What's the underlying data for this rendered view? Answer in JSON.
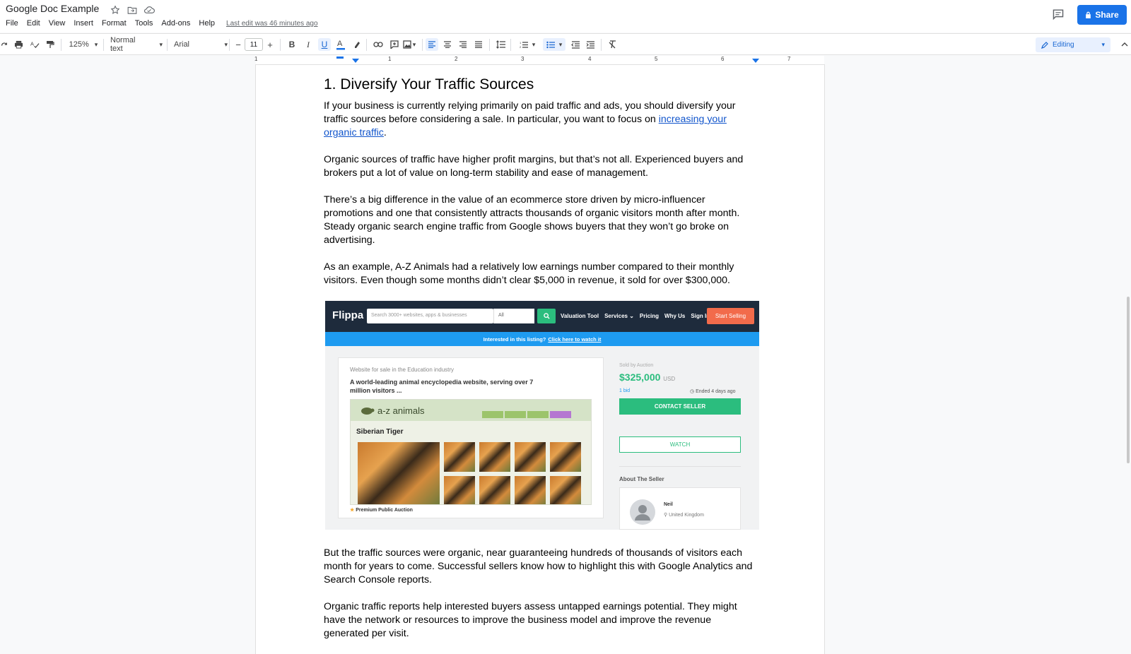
{
  "header": {
    "doc_title": "Google Doc Example",
    "last_edit": "Last edit was 46 minutes ago",
    "share_label": "Share",
    "menu": [
      "File",
      "Edit",
      "View",
      "Insert",
      "Format",
      "Tools",
      "Add-ons",
      "Help"
    ]
  },
  "toolbar": {
    "zoom": "125%",
    "style": "Normal text",
    "font": "Arial",
    "font_size": "11",
    "mode": "Editing"
  },
  "ruler": {
    "marks": [
      "1",
      "1",
      "2",
      "3",
      "4",
      "5",
      "6",
      "7"
    ]
  },
  "document": {
    "heading": "1. Diversify Your Traffic Sources",
    "p1_before": "If your business is currently relying primarily on paid traffic and ads, you should diversify your traffic sources before considering a sale. In particular, you want to focus on ",
    "p1_link": "increasing your organic traffic",
    "p1_after": ".",
    "p2": "Organic sources of traffic have higher profit margins, but that’s not all. Experienced buyers and brokers put a lot of value on long-term stability and ease of management.",
    "p3": "There’s a big difference in the value of an ecommerce store driven by micro-influencer promotions and one that consistently attracts thousands of organic visitors month after month. Steady organic search engine traffic from Google shows buyers that they won’t go broke on advertising.",
    "p4": "As an example, A-Z Animals had a relatively low earnings number compared to their monthly visitors. Even though some months didn’t clear $5,000 in revenue, it sold for over $300,000.",
    "p5": "But the traffic sources were organic, near guaranteeing hundreds of thousands of visitors each month for years to come. Successful sellers know how to highlight this with Google Analytics and Search Console reports.",
    "p6": "Organic traffic reports help interested buyers assess untapped earnings potential. They might have the network or resources to improve the business model and improve the revenue generated per visit."
  },
  "embed": {
    "logo": "Flippa",
    "search_placeholder": "Search 3000+ websites, apps & businesses",
    "search_filter": "All",
    "nav_links": [
      "Valuation Tool",
      "Services ⌄",
      "Pricing",
      "Why Us",
      "Sign In"
    ],
    "start_selling": "Start Selling",
    "banner_text": "Interested in this listing?",
    "banner_link": "Click here to watch it",
    "listing_sub": "Website for sale in the Education industry",
    "listing_headline": "A world-leading animal encyclopedia website, serving over 7 million visitors ...",
    "az_logo": "a-z animals",
    "az_page_title": "Siberian Tiger",
    "premium": "Premium Public Auction",
    "sold_by": "Sold by Auction",
    "price": "$325,000",
    "currency": "USD",
    "bids": "1 bid",
    "ended": "Ended 4 days ago",
    "contact": "CONTACT SELLER",
    "watch": "WATCH",
    "about": "About The Seller",
    "seller_name": "Neil",
    "seller_location": "United Kingdom"
  },
  "colors": {
    "share_blue": "#1a73e8",
    "link_blue": "#1155cc",
    "flippa_navy": "#1e2b3c",
    "flippa_green": "#2bbd7e",
    "flippa_orange": "#f26b4b"
  }
}
